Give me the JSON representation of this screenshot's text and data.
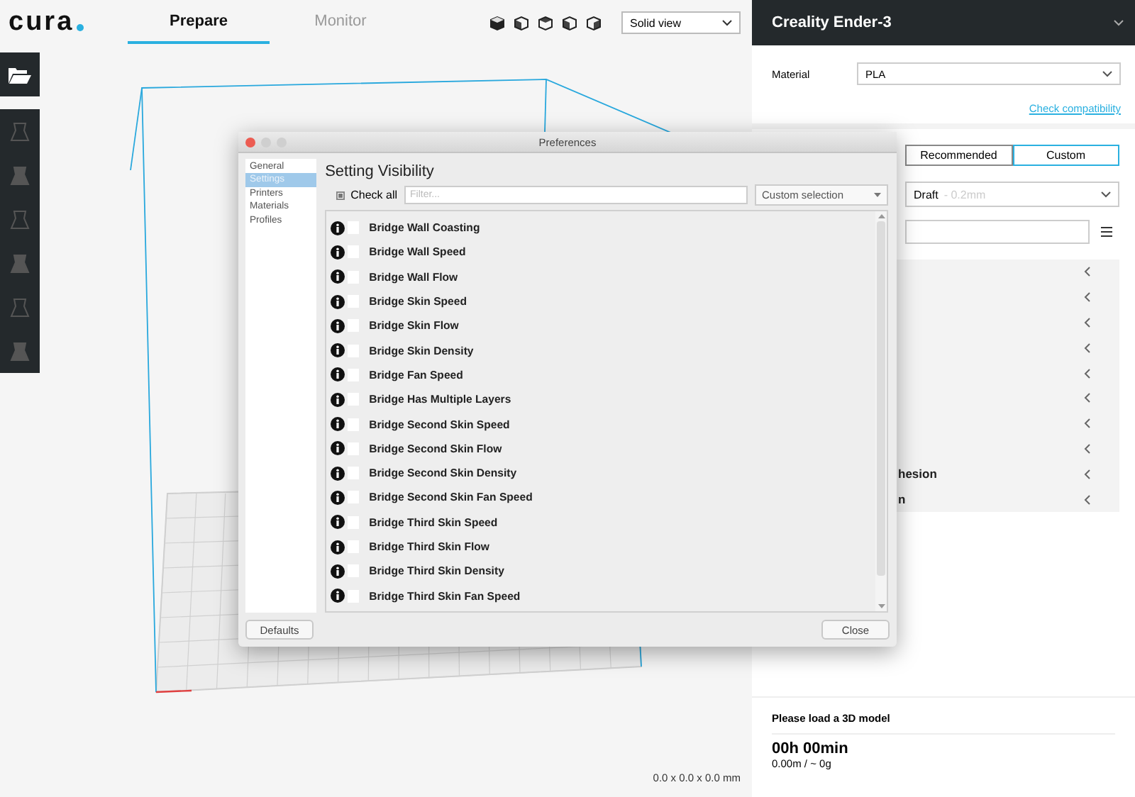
{
  "app": {
    "logo": "cura",
    "tabs": [
      {
        "label": "Prepare",
        "selected": true
      },
      {
        "label": "Monitor",
        "selected": false
      }
    ],
    "view_mode": "Solid view"
  },
  "dimensions": "0.0 x 0.0 x 0.0 mm",
  "sidebar": {
    "printer": "Creality Ender-3",
    "material_label": "Material",
    "material": "PLA",
    "check_link": "Check compatibility",
    "modes": [
      {
        "label": "Recommended",
        "selected": false
      },
      {
        "label": "Custom",
        "selected": true
      }
    ],
    "profile": "Draft",
    "profile_detail": "- 0.2mm",
    "categories": [
      {
        "expanded": false
      },
      {
        "expanded": false
      },
      {
        "expanded": false
      },
      {
        "expanded": false
      },
      {
        "expanded": false
      },
      {
        "expanded": false
      },
      {
        "expanded": false
      },
      {
        "expanded": false
      },
      {
        "label": "hesion",
        "expanded": false
      },
      {
        "label": "n",
        "expanded": false
      }
    ]
  },
  "job": {
    "status": "Please load a 3D model",
    "time": "00h 00min",
    "usage": "0.00m / ~ 0g"
  },
  "dialog": {
    "title": "Preferences",
    "pages": [
      {
        "label": "General",
        "selected": false
      },
      {
        "label": "Settings",
        "selected": true
      },
      {
        "label": "Printers",
        "selected": false
      },
      {
        "label": "Materials",
        "selected": false
      },
      {
        "label": "Profiles",
        "selected": false
      }
    ],
    "heading": "Setting Visibility",
    "check_all": {
      "label": "Check all",
      "indeterminate": true
    },
    "filter_placeholder": "Filter...",
    "preset": "Custom selection",
    "settings": [
      {
        "label": "Bridge Wall Coasting",
        "checked": false
      },
      {
        "label": "Bridge Wall Speed",
        "checked": false
      },
      {
        "label": "Bridge Wall Flow",
        "checked": false
      },
      {
        "label": "Bridge Skin Speed",
        "checked": false
      },
      {
        "label": "Bridge Skin Flow",
        "checked": false
      },
      {
        "label": "Bridge Skin Density",
        "checked": false
      },
      {
        "label": "Bridge Fan Speed",
        "checked": false
      },
      {
        "label": "Bridge Has Multiple Layers",
        "checked": false
      },
      {
        "label": "Bridge Second Skin Speed",
        "checked": false
      },
      {
        "label": "Bridge Second Skin Flow",
        "checked": false
      },
      {
        "label": "Bridge Second Skin Density",
        "checked": false
      },
      {
        "label": "Bridge Second Skin Fan Speed",
        "checked": false
      },
      {
        "label": "Bridge Third Skin Speed",
        "checked": false
      },
      {
        "label": "Bridge Third Skin Flow",
        "checked": false
      },
      {
        "label": "Bridge Third Skin Density",
        "checked": false
      },
      {
        "label": "Bridge Third Skin Fan Speed",
        "checked": false
      }
    ],
    "defaults_button": "Defaults",
    "close_button": "Close"
  }
}
